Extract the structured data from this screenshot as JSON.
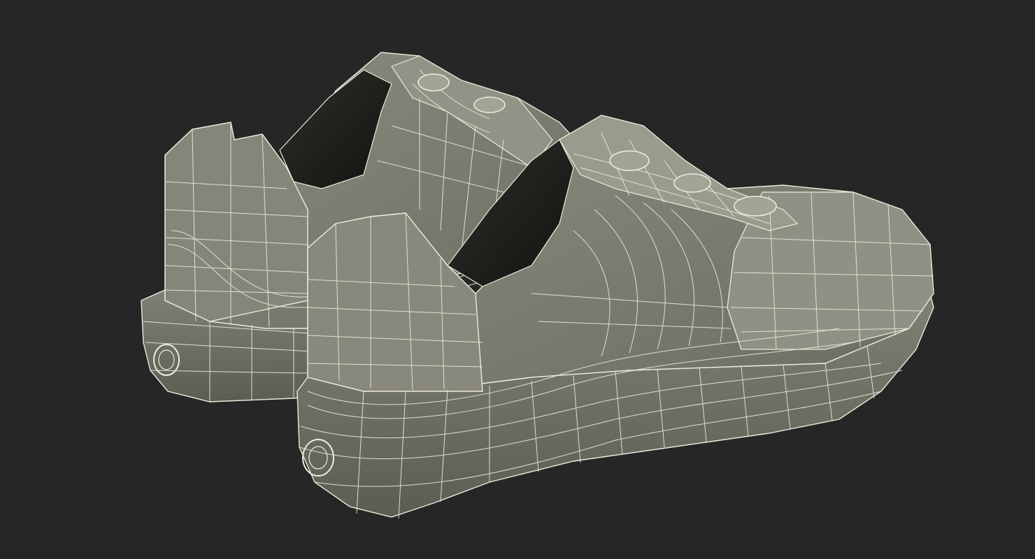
{
  "scene": {
    "subject": "wireframe-shoe-pair",
    "colors": {
      "background": "#262626",
      "surface": "#7d7d72",
      "surface_light": "#8e8e82",
      "surface_dark": "#5e5e55",
      "interior": "#1b1c18",
      "wire": "#ecebdc"
    }
  }
}
